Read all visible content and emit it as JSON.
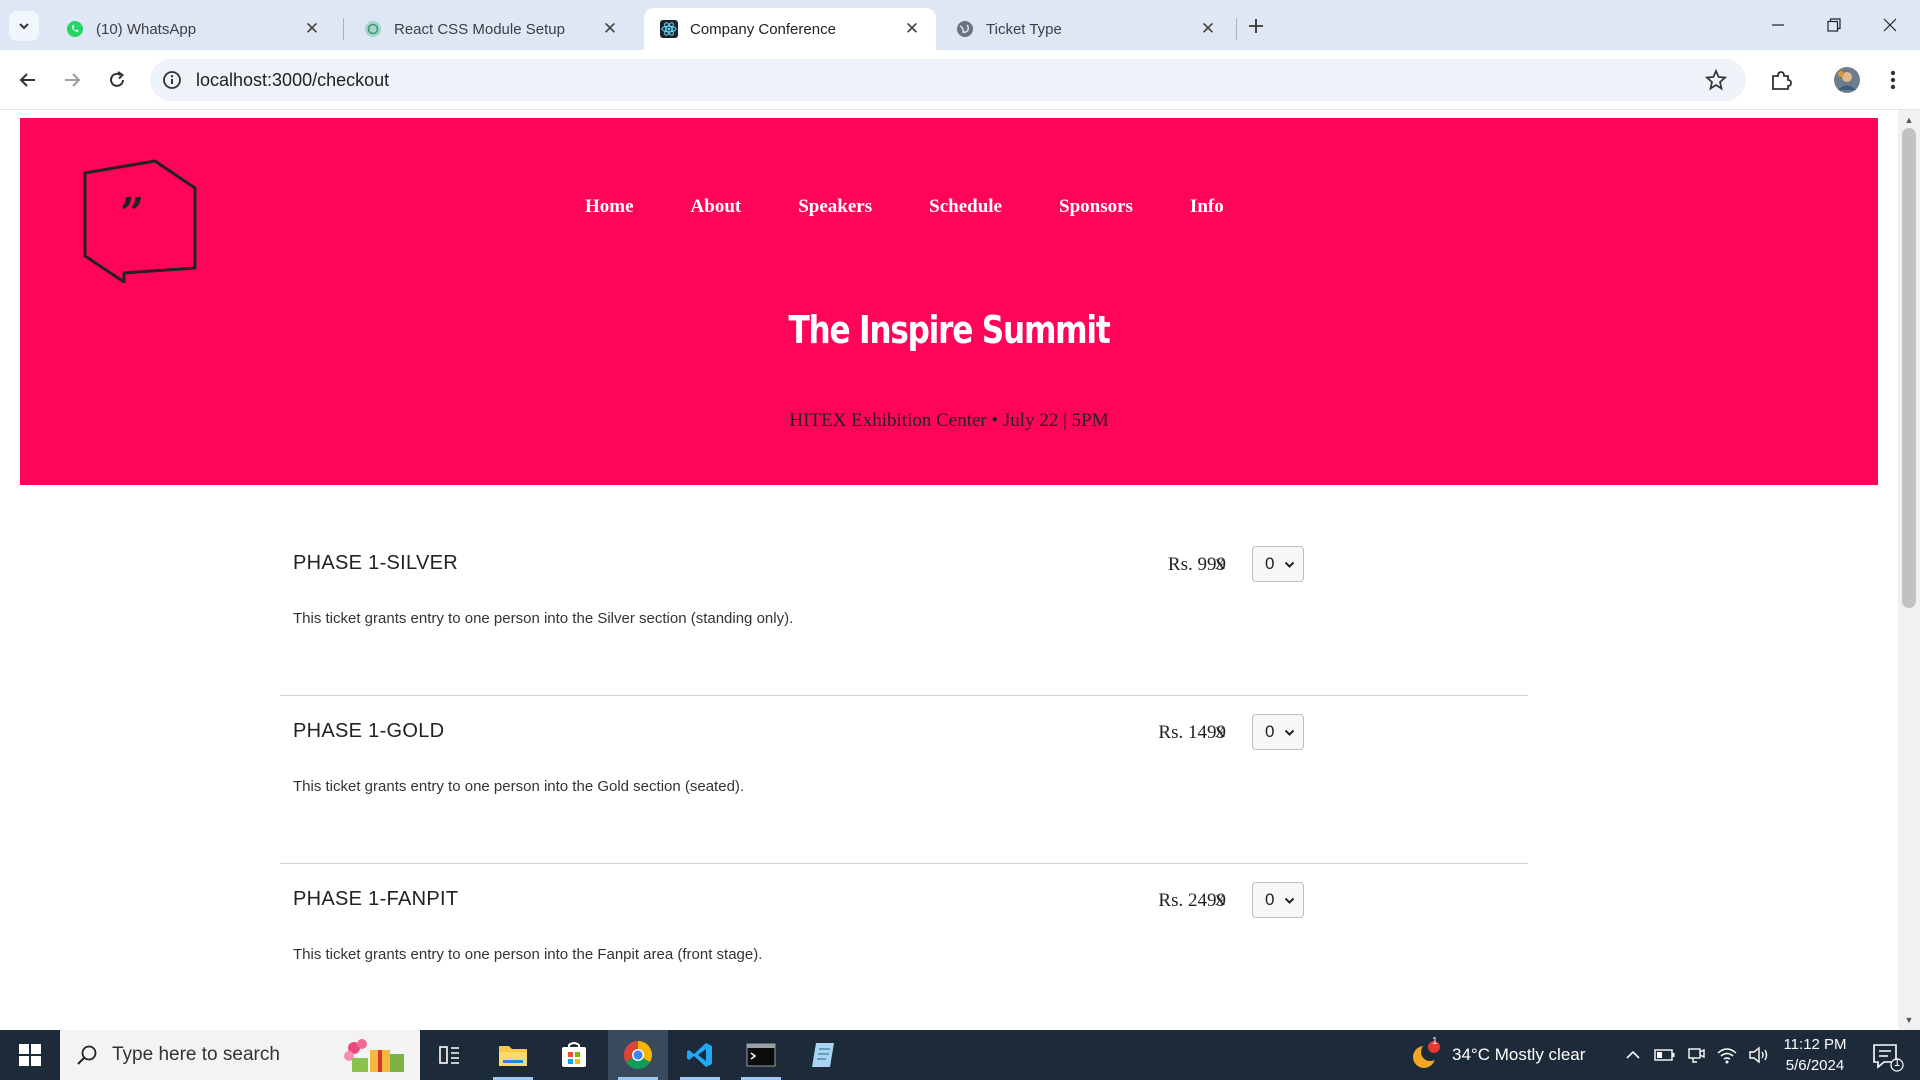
{
  "browser": {
    "tabs": [
      {
        "title": "(10) WhatsApp",
        "icon": "whatsapp-icon"
      },
      {
        "title": "React CSS Module Setup",
        "icon": "chatgpt-icon"
      },
      {
        "title": "Company Conference",
        "icon": "react-icon"
      },
      {
        "title": "Ticket Type",
        "icon": "globe-icon"
      }
    ],
    "url": "localhost:3000/checkout"
  },
  "page": {
    "nav": [
      "Home",
      "About",
      "Speakers",
      "Schedule",
      "Sponsors",
      "Info"
    ],
    "title": "The Inspire Summit",
    "subtitle": "HITEX Exhibition Center • July 22 | 5PM",
    "tickets": [
      {
        "name": "PHASE 1-SILVER",
        "price": "Rs. 999",
        "multiplier": "x",
        "quantity": "0",
        "description": "This ticket grants entry to one person into the Silver section (standing only)."
      },
      {
        "name": "PHASE 1-GOLD",
        "price": "Rs. 1499",
        "multiplier": "x",
        "quantity": "0",
        "description": "This ticket grants entry to one person into the Gold section (seated)."
      },
      {
        "name": "PHASE 1-FANPIT",
        "price": "Rs. 2499",
        "multiplier": "x",
        "quantity": "0",
        "description": "This ticket grants entry to one person into the Fanpit area (front stage)."
      }
    ],
    "colors": {
      "hero": "#ff0558"
    }
  },
  "taskbar": {
    "search_placeholder": "Type here to search",
    "weather": "34°C  Mostly clear",
    "weather_badge": "1",
    "time": "11:12 PM",
    "date": "5/6/2024",
    "notification_count": "1"
  }
}
